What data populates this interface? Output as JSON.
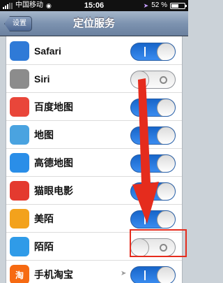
{
  "status_bar": {
    "carrier": "中国移动",
    "time": "15:06",
    "battery_text": "52 %",
    "battery_level": 0.52
  },
  "nav": {
    "back_label": "设置",
    "title": "定位服务"
  },
  "apps": [
    {
      "name": "Safari",
      "enabled": true,
      "icon": "safari-icon",
      "color": "#2f7ad7"
    },
    {
      "name": "Siri",
      "enabled": false,
      "icon": "microphone-icon",
      "color": "#8c8c8c"
    },
    {
      "name": "百度地图",
      "enabled": true,
      "icon": "baidu-map-icon",
      "color": "#e9463a"
    },
    {
      "name": "地图",
      "enabled": true,
      "icon": "maps-icon",
      "color": "#4aa3e0"
    },
    {
      "name": "高德地图",
      "enabled": true,
      "icon": "amap-icon",
      "color": "#2a8ee8"
    },
    {
      "name": "猫眼电影",
      "enabled": true,
      "icon": "maoyan-icon",
      "color": "#e43a2f"
    },
    {
      "name": "美陌",
      "enabled": true,
      "icon": "meimo-icon",
      "color": "#f3a21c"
    },
    {
      "name": "陌陌",
      "enabled": false,
      "icon": "momo-icon",
      "color": "#2f9be8"
    },
    {
      "name": "手机淘宝",
      "enabled": true,
      "icon": "taobao-icon",
      "color": "#f66a12",
      "badge": "淘"
    }
  ],
  "colors": {
    "switch_on": "#2b7be0",
    "annotation": "#e52c1d",
    "nav_bar": "#7d93b0"
  }
}
